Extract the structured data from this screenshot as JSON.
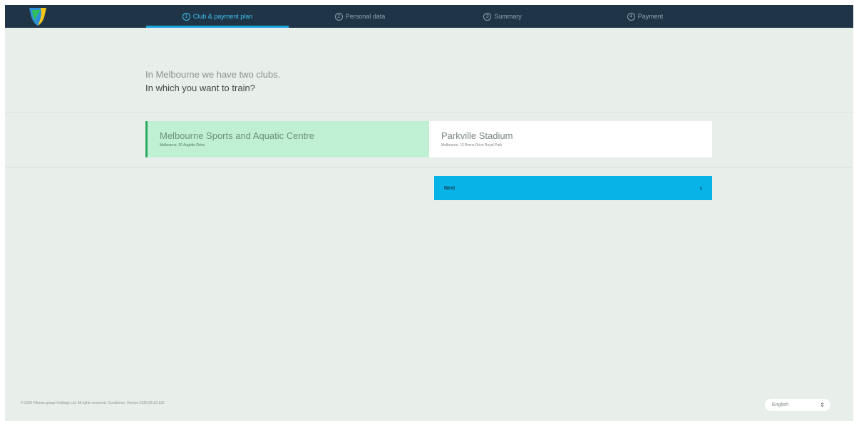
{
  "nav": {
    "steps": [
      {
        "num": "1",
        "label": "Club & payment plan"
      },
      {
        "num": "2",
        "label": "Personal data"
      },
      {
        "num": "3",
        "label": "Summary"
      },
      {
        "num": "4",
        "label": "Payment"
      }
    ],
    "active_index": 0
  },
  "heading": {
    "line1": "In Melbourne we have two clubs.",
    "line2": "In which you want to train?"
  },
  "clubs": [
    {
      "name": "Melbourne Sports and Aquatic Centre",
      "address": "Melbourne, 30 Aughtie Drive",
      "selected": true
    },
    {
      "name": "Parkville Stadium",
      "address": "Melbourne, 12 Brens Drive Royal Park",
      "selected": false
    }
  ],
  "next_button": {
    "label": "Next",
    "icon": "chevron-right-icon"
  },
  "footer": {
    "copyright": "© 2020 Fitness group Holdings Ltd. All rights reserved. Conditions. Version 2020.05.12.120"
  },
  "language": {
    "selected": "English"
  },
  "colors": {
    "topbar": "#1f3547",
    "accent": "#08b3e8",
    "selected_bg": "#bff0d3",
    "selected_border": "#2da960",
    "page_bg": "#e8eeea"
  }
}
